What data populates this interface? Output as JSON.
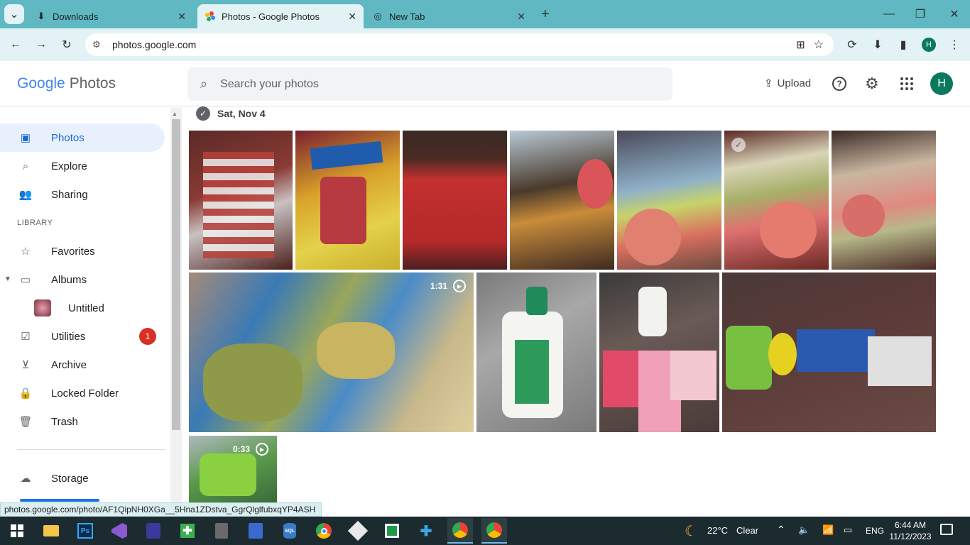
{
  "browser": {
    "tabs": [
      {
        "label": "Downloads"
      },
      {
        "label": "Photos - Google Photos"
      },
      {
        "label": "New Tab"
      }
    ],
    "url": "photos.google.com",
    "profile_initial": "H"
  },
  "app": {
    "logo_google": "Google",
    "logo_photos": "Photos",
    "search_placeholder": "Search your photos",
    "upload_label": "Upload",
    "avatar_initial": "H"
  },
  "sidebar": {
    "items": [
      {
        "label": "Photos",
        "icon": "photo-icon"
      },
      {
        "label": "Explore",
        "icon": "search-icon"
      },
      {
        "label": "Sharing",
        "icon": "people-icon"
      }
    ],
    "library_header": "LIBRARY",
    "library": [
      {
        "label": "Favorites",
        "icon": "star-icon"
      },
      {
        "label": "Albums",
        "icon": "album-icon"
      },
      {
        "label": "Untitled",
        "icon": "album-thumb"
      },
      {
        "label": "Utilities",
        "icon": "checklist-icon",
        "badge": "1"
      },
      {
        "label": "Archive",
        "icon": "archive-icon"
      },
      {
        "label": "Locked Folder",
        "icon": "lock-icon"
      },
      {
        "label": "Trash",
        "icon": "trash-icon"
      },
      {
        "label": "Storage",
        "icon": "cloud-icon"
      }
    ]
  },
  "main": {
    "date_header": "Sat, Nov 4",
    "videos": [
      {
        "duration": "1:31"
      },
      {
        "duration": "0:33"
      }
    ]
  },
  "status_url": "photos.google.com/photo/AF1QipNH0XGa__5Hna1ZDstva_GgrQlglfubxqYP4ASH",
  "taskbar": {
    "weather_temp": "22°C",
    "weather_desc": "Clear",
    "lang": "ENG",
    "time": "6:44 AM",
    "date": "11/12/2023"
  },
  "colors": {
    "tabbar": "#5fb8c2",
    "accent": "#1967d2",
    "avatar": "#0a7a5f",
    "badge": "#d93025"
  }
}
